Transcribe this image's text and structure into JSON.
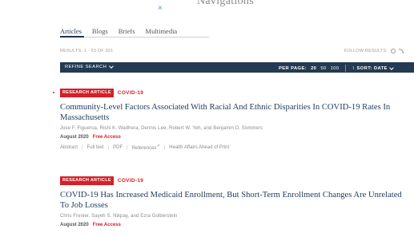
{
  "header": {
    "close_symbol": "×",
    "site_title": "Navigations"
  },
  "tabs": [
    "Articles",
    "Blogs",
    "Briefs",
    "Multimedia"
  ],
  "results": {
    "summary": "RESULTS: 1 - 20 OF 321",
    "follow_label": "FOLLOW RESULTS:"
  },
  "toolbar": {
    "refine_label": "REFINE SEARCH",
    "per_page_label": "PER PAGE:",
    "per_page_options": [
      "20",
      "50",
      "100"
    ],
    "per_page_selected": "20",
    "sort_label": "SORT: DATE"
  },
  "articles": [
    {
      "type_badge": "RESEARCH ARTICLE",
      "topic": "COVID-19",
      "title": "Community-Level Factors Associated With Racial And Ethnic Disparities In COVID-19 Rates In Massachusetts",
      "authors": "Jose F. Figueroa, Rishi K. Wadhera, Dennis Lee, Robert W. Yeh, and Benjamin D. Sommers",
      "date": "August 2020",
      "access": "Free Access",
      "links": [
        "Abstract",
        "Full text",
        "PDF",
        "References",
        "Health Affairs Ahead of Print"
      ]
    },
    {
      "type_badge": "RESEARCH ARTICLE",
      "topic": "COVID-19",
      "title": "COVID-19 Has Increased Medicaid Enrollment, But Short-Term Enrollment Changes Are Unrelated To Job Losses",
      "authors": "Chris Frenier, Sayeh S. Nikpay, and Ezra Golberstein",
      "date": "August 2020",
      "access": "Free Access"
    }
  ],
  "colors": {
    "navy_bar": "#233a52",
    "title_blue": "#1e3a5c",
    "accent_red": "#d61f26"
  }
}
